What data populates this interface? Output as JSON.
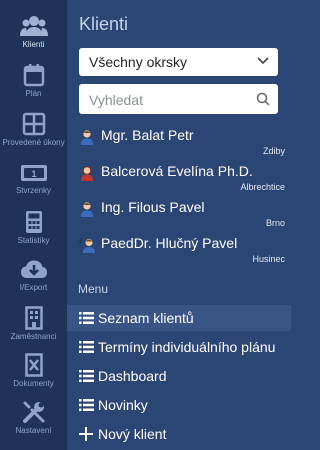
{
  "rail": [
    {
      "label": "Klienti",
      "icon": "people-icon"
    },
    {
      "label": "Plán",
      "icon": "calendar-icon"
    },
    {
      "label": "Provedené úkony",
      "icon": "grid-icon"
    },
    {
      "label": "Stvrzenky",
      "icon": "money-icon"
    },
    {
      "label": "Statistiky",
      "icon": "calculator-icon"
    },
    {
      "label": "I/Export",
      "icon": "cloud-download-icon"
    },
    {
      "label": "Zaměstnanci",
      "icon": "building-icon"
    },
    {
      "label": "Dokumenty",
      "icon": "document-icon"
    },
    {
      "label": "Nastavení",
      "icon": "tools-icon"
    }
  ],
  "panel": {
    "title": "Klienti",
    "district_select": "Všechny okrsky",
    "search_placeholder": "Vyhledat"
  },
  "clients": [
    {
      "name": "Mgr. Balat Petr",
      "city": "Zdiby",
      "icon": "person-male-icon"
    },
    {
      "name": "Balcerová Evelína Ph.D.",
      "city": "Albrechtice",
      "icon": "person-female-icon"
    },
    {
      "name": "Ing. Filous Pavel",
      "city": "Brno",
      "icon": "person-male-icon"
    },
    {
      "name": "PaedDr. Hlučný Pavel",
      "city": "Husinec",
      "icon": "person-male-sleeping-icon",
      "badge": "Z"
    }
  ],
  "menu": {
    "heading": "Menu",
    "items": [
      {
        "label": "Seznam klientů",
        "icon": "list-icon",
        "active": true
      },
      {
        "label": "Termíny individuálního plánu",
        "icon": "list-icon"
      },
      {
        "label": "Dashboard",
        "icon": "list-icon"
      },
      {
        "label": "Novinky",
        "icon": "list-icon"
      },
      {
        "label": "Nový klient",
        "icon": "plus-icon"
      }
    ]
  },
  "colors": {
    "rail_bg": "#1e3357",
    "panel_bg": "#2b4675",
    "active_bg": "#3a5585",
    "rail_icon": "#8fa4c8"
  }
}
